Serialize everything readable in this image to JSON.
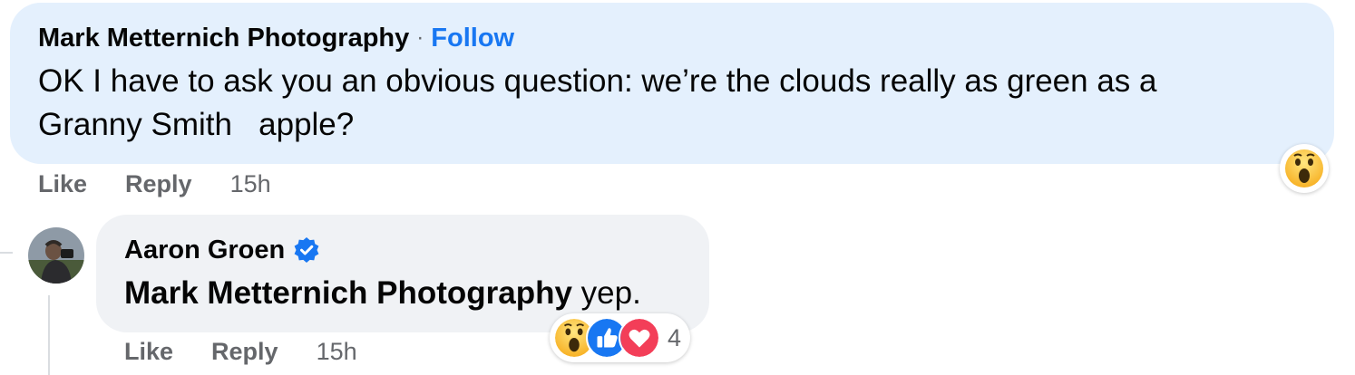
{
  "comment1": {
    "author": "Mark Metternich Photography",
    "separator": "·",
    "follow_label": "Follow",
    "text": "OK I have to ask you an obvious question: we’re the clouds really as green as a\nGranny Smith   apple?",
    "reaction_icon": "wow-emoji-icon",
    "actions": {
      "like": "Like",
      "reply": "Reply",
      "time": "15h"
    }
  },
  "reply": {
    "author": "Aaron Groen",
    "verified_icon": "verified-badge-icon",
    "mention": "Mark Metternich Photography",
    "text": " yep.",
    "reactions": {
      "icons": [
        "wow-emoji-icon",
        "like-icon",
        "love-icon"
      ],
      "count": "4"
    },
    "actions": {
      "like": "Like",
      "reply": "Reply",
      "time": "15h"
    }
  },
  "colors": {
    "link_blue": "#1877f2",
    "bubble_blue": "#e4f0fd",
    "bubble_gray": "#f0f2f5",
    "secondary_text": "#65676b"
  }
}
